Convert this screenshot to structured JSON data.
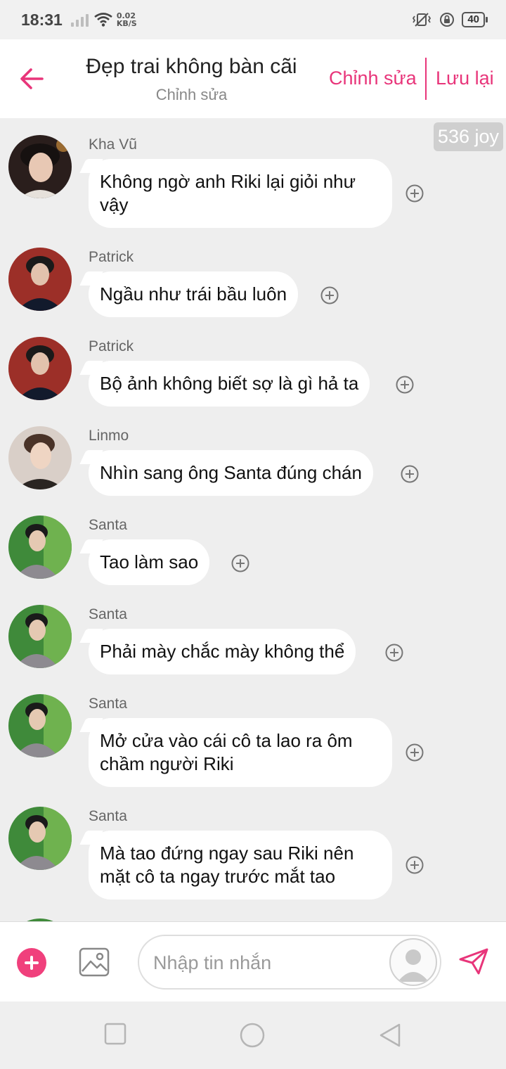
{
  "status_bar": {
    "time": "18:31",
    "net_speed_value": "0.02",
    "net_speed_unit": "KB/S",
    "battery": "40"
  },
  "header": {
    "title": "Đẹp trai không bàn cãi",
    "subtitle": "Chỉnh sửa",
    "edit_label": "Chỉnh sửa",
    "save_label": "Lưu lại"
  },
  "chat": {
    "joy_badge": "536 joy",
    "messages": [
      {
        "sender": "Kha Vũ",
        "text": "Không ngờ anh Riki lại giỏi như vậy",
        "avatar": "kha-vu"
      },
      {
        "sender": "Patrick",
        "text": "Ngầu như trái bầu luôn",
        "avatar": "patrick"
      },
      {
        "sender": "Patrick",
        "text": "Bộ ảnh không biết sợ là gì hả ta",
        "avatar": "patrick"
      },
      {
        "sender": "Linmo",
        "text": "Nhìn sang ông Santa đúng chán",
        "avatar": "linmo"
      },
      {
        "sender": "Santa",
        "text": "Tao làm sao",
        "avatar": "santa"
      },
      {
        "sender": "Santa",
        "text": "Phải mày chắc mày không thể",
        "avatar": "santa"
      },
      {
        "sender": "Santa",
        "text": "Mở cửa vào cái cô ta lao ra ôm chầm người Riki",
        "avatar": "santa"
      },
      {
        "sender": "Santa",
        "text": "Mà tao đứng ngay sau Riki nên mặt cô ta ngay trước mắt tao",
        "avatar": "santa"
      }
    ]
  },
  "input_bar": {
    "placeholder": "Nhập tin nhắn"
  },
  "colors": {
    "accent": "#e8357a",
    "plus_button": "#f0407c",
    "chat_background": "#eeeeee"
  },
  "icons": {
    "back": "back-arrow-icon",
    "react": "plus-circle-icon",
    "add": "plus-icon",
    "image": "image-icon",
    "send": "send-icon",
    "nav": [
      "square-icon",
      "circle-icon",
      "triangle-back-icon"
    ]
  }
}
